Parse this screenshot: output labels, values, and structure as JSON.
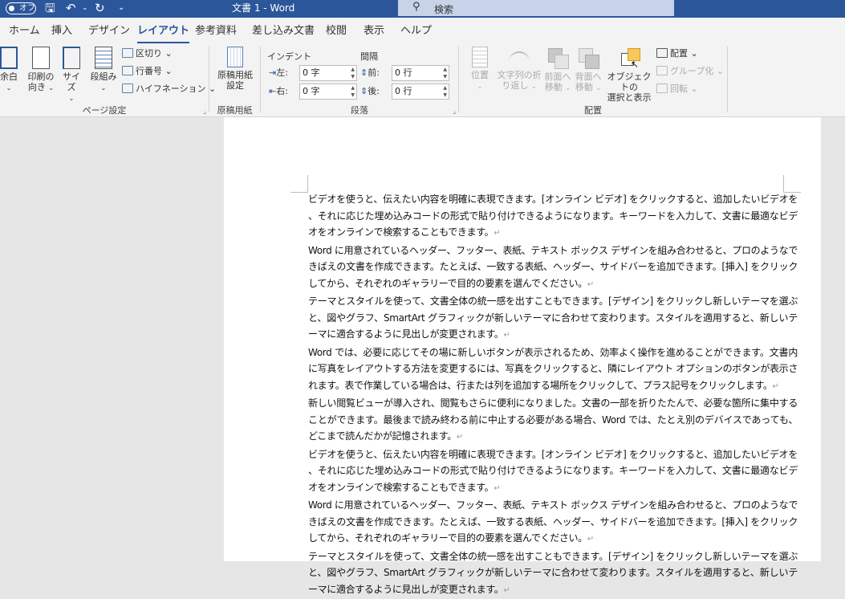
{
  "titlebar": {
    "autosave": "オフ",
    "title": "文書 1 - Word"
  },
  "search": {
    "placeholder": "検索"
  },
  "tabs": [
    "ホーム",
    "挿入",
    "デザイン",
    "レイアウト",
    "参考資料",
    "差し込み文書",
    "校閲",
    "表示",
    "ヘルプ"
  ],
  "active_tab": "レイアウト",
  "ribbon": {
    "page_setup": {
      "label": "ページ設定",
      "margins": "余白",
      "orientation1": "印刷の",
      "orientation2": "向き",
      "size": "サイズ",
      "columns": "段組み",
      "breaks": "区切り",
      "line_numbers": "行番号",
      "hyphenation": "ハイフネーション"
    },
    "genko": {
      "label": "原稿用紙",
      "btn1": "原稿用紙",
      "btn2": "設定"
    },
    "paragraph": {
      "label": "段落",
      "indent": "インデント",
      "spacing": "間隔",
      "left": "左:",
      "right": "右:",
      "before": "前:",
      "after": "後:",
      "left_val": "0 字",
      "right_val": "0 字",
      "before_val": "0 行",
      "after_val": "0 行"
    },
    "arrange": {
      "label": "配置",
      "position": "位置",
      "wrap1": "文字列の折",
      "wrap2": "り返し",
      "forward1": "前面へ",
      "forward2": "移動",
      "backward1": "背面へ",
      "backward2": "移動",
      "selection1": "オブジェクトの",
      "selection2": "選択と表示",
      "align": "配置",
      "group": "グループ化",
      "rotate": "回転"
    }
  },
  "document": {
    "paragraphs": [
      "ビデオを使うと、伝えたい内容を明確に表現できます。[オンライン ビデオ] をクリックすると、追加したいビデオを、それに応じた埋め込みコードの形式で貼り付けできるようになります。キーワードを入力して、文書に最適なビデオをオンラインで検索することもできます。",
      "Word に用意されているヘッダー、フッター、表紙、テキスト ボックス デザインを組み合わせると、プロのようなできばえの文書を作成できます。たとえば、一致する表紙、ヘッダー、サイドバーを追加できます。[挿入] をクリックしてから、それぞれのギャラリーで目的の要素を選んでください。",
      "テーマとスタイルを使って、文書全体の統一感を出すこともできます。[デザイン] をクリックし新しいテーマを選ぶと、図やグラフ、SmartArt グラフィックが新しいテーマに合わせて変わります。スタイルを適用すると、新しいテーマに適合するように見出しが変更されます。",
      "Word では、必要に応じてその場に新しいボタンが表示されるため、効率よく操作を進めることができます。文書内に写真をレイアウトする方法を変更するには、写真をクリックすると、隣にレイアウト オプションのボタンが表示されます。表で作業している場合は、行または列を追加する場所をクリックして、プラス記号をクリックします。",
      "新しい閲覧ビューが導入され、閲覧もさらに便利になりました。文書の一部を折りたたんで、必要な箇所に集中することができます。最後まで読み終わる前に中止する必要がある場合、Word では、たとえ別のデバイスであっても、どこまで読んだかが記憶されます。",
      "ビデオを使うと、伝えたい内容を明確に表現できます。[オンライン ビデオ] をクリックすると、追加したいビデオを、それに応じた埋め込みコードの形式で貼り付けできるようになります。キーワードを入力して、文書に最適なビデオをオンラインで検索することもできます。",
      "Word に用意されているヘッダー、フッター、表紙、テキスト ボックス デザインを組み合わせると、プロのようなできばえの文書を作成できます。たとえば、一致する表紙、ヘッダー、サイドバーを追加できます。[挿入] をクリックしてから、それぞれのギャラリーで目的の要素を選んでください。",
      "テーマとスタイルを使って、文書全体の統一感を出すこともできます。[デザイン] をクリックし新しいテーマを選ぶと、図やグラフ、SmartArt グラフィックが新しいテーマに合わせて変わります。スタイルを適用すると、新しいテーマに適合するように見出しが変更されます。"
    ],
    "paragraph_mark": "↵"
  },
  "colors": {
    "brand": "#2b579a",
    "ribbon_bg": "#f3f3f3",
    "canvas": "#e6e6e6"
  }
}
